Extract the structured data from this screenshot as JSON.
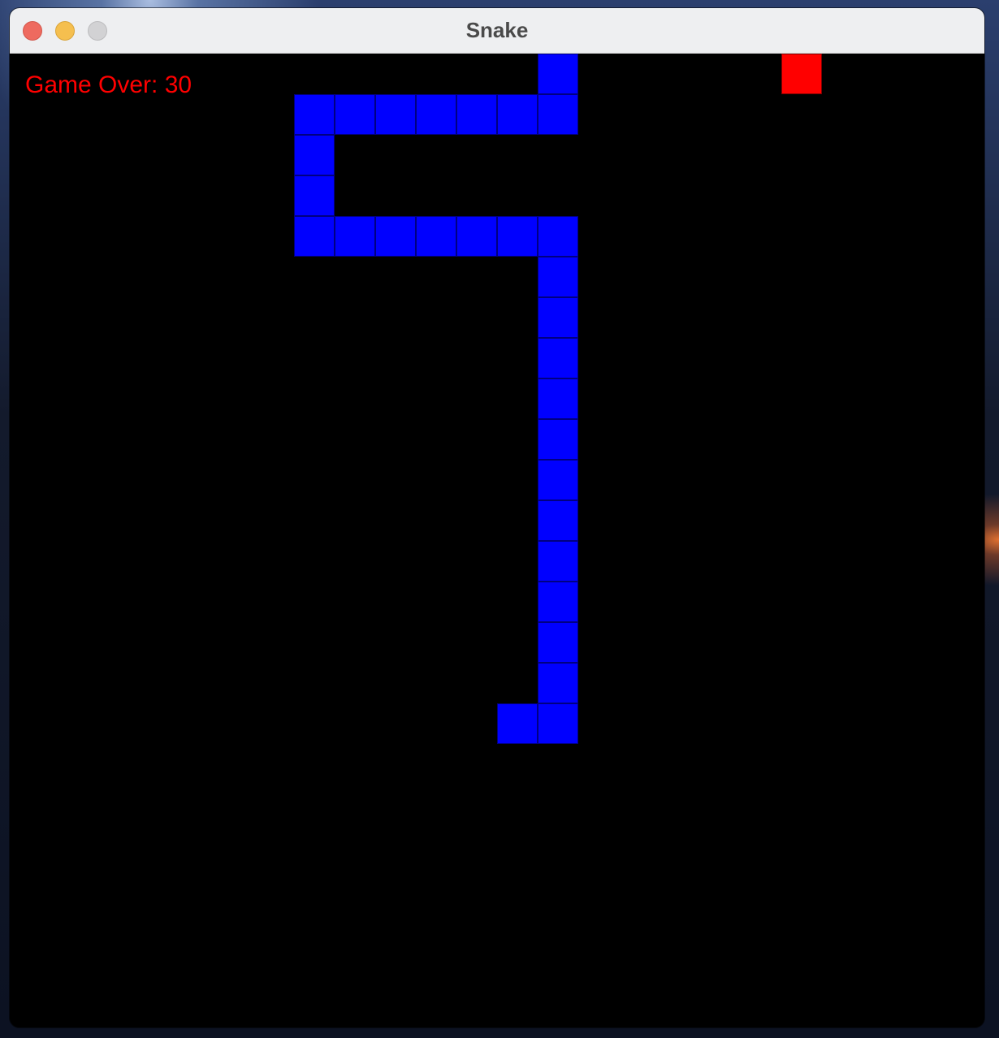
{
  "window": {
    "title": "Snake",
    "buttons": [
      {
        "name": "close",
        "color": "#ee6a5f",
        "border": "#d2564b"
      },
      {
        "name": "minimize",
        "color": "#f5bf4f",
        "border": "#d9a43a"
      },
      {
        "name": "zoom",
        "color": "#d2d2d4",
        "border": "#bcbcbe"
      }
    ]
  },
  "game": {
    "status_text": "Game Over: 30",
    "colors": {
      "background": "#000000",
      "snake": "#0000ff",
      "food": "#ff0000",
      "text": "#ff0000"
    },
    "food": {
      "col": 19,
      "row": 0
    },
    "snake": [
      {
        "col": 13,
        "row": 0
      },
      {
        "col": 13,
        "row": 1
      },
      {
        "col": 12,
        "row": 1
      },
      {
        "col": 11,
        "row": 1
      },
      {
        "col": 10,
        "row": 1
      },
      {
        "col": 9,
        "row": 1
      },
      {
        "col": 8,
        "row": 1
      },
      {
        "col": 7,
        "row": 1
      },
      {
        "col": 7,
        "row": 2
      },
      {
        "col": 7,
        "row": 3
      },
      {
        "col": 7,
        "row": 4
      },
      {
        "col": 8,
        "row": 4
      },
      {
        "col": 9,
        "row": 4
      },
      {
        "col": 10,
        "row": 4
      },
      {
        "col": 11,
        "row": 4
      },
      {
        "col": 12,
        "row": 4
      },
      {
        "col": 13,
        "row": 4
      },
      {
        "col": 13,
        "row": 5
      },
      {
        "col": 13,
        "row": 6
      },
      {
        "col": 13,
        "row": 7
      },
      {
        "col": 13,
        "row": 8
      },
      {
        "col": 13,
        "row": 9
      },
      {
        "col": 13,
        "row": 10
      },
      {
        "col": 13,
        "row": 11
      },
      {
        "col": 13,
        "row": 12
      },
      {
        "col": 13,
        "row": 13
      },
      {
        "col": 13,
        "row": 14
      },
      {
        "col": 13,
        "row": 15
      },
      {
        "col": 13,
        "row": 16
      },
      {
        "col": 12,
        "row": 16
      }
    ]
  }
}
